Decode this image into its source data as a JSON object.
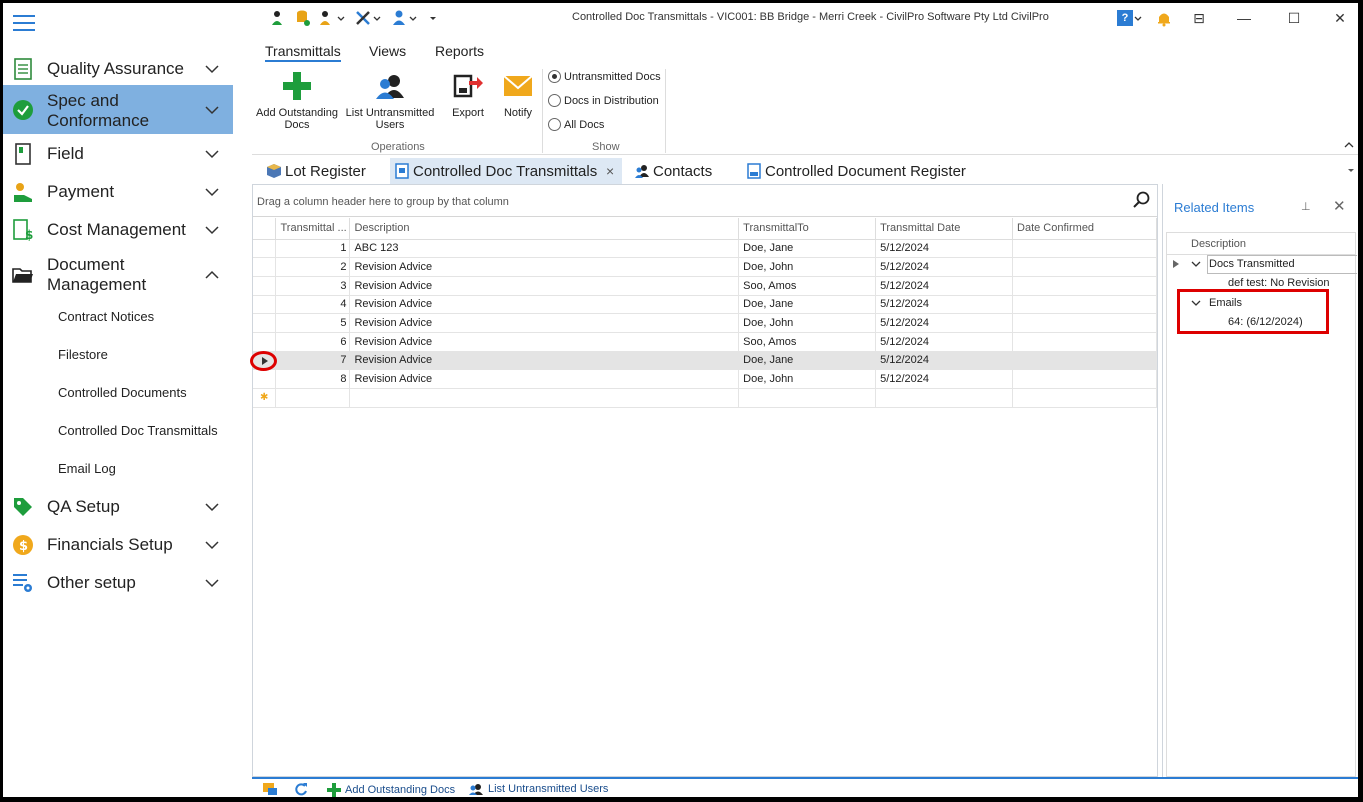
{
  "window": {
    "title": "Controlled Doc Transmittals - VIC001: BB Bridge -  Merri Creek  - CivilPro Software Pty Ltd CivilPro",
    "help_label": "?",
    "restore_label": "⊟",
    "minimize_label": "—",
    "maximize_label": "☐",
    "close_label": "✕"
  },
  "sidebar": {
    "items": [
      {
        "label": "Quality Assurance"
      },
      {
        "label": "Spec and\nConformance"
      },
      {
        "label": "Field"
      },
      {
        "label": "Payment"
      },
      {
        "label": "Cost Management"
      },
      {
        "label": "Document\nManagement"
      },
      {
        "label": "QA Setup"
      },
      {
        "label": "Financials Setup"
      },
      {
        "label": "Other setup"
      }
    ],
    "sub_items": [
      "Contract Notices",
      "Filestore",
      "Controlled Documents",
      "Controlled Doc Transmittals",
      "Email Log"
    ]
  },
  "ribbon": {
    "tabs": [
      "Transmittals",
      "Views",
      "Reports"
    ],
    "buttons": {
      "add_outstanding": "Add Outstanding\nDocs",
      "list_untransmitted": "List Untransmitted\nUsers",
      "export": "Export",
      "notify": "Notify"
    },
    "groups": {
      "operations": "Operations",
      "show": "Show"
    },
    "radios": [
      "Untransmitted Docs",
      "Docs in Distribution",
      "All Docs"
    ],
    "selected_radio": 0
  },
  "doc_tabs": [
    "Lot Register",
    "Controlled Doc Transmittals",
    "Contacts",
    "Controlled Document Register"
  ],
  "doc_tab_close": "×",
  "grid": {
    "group_hint": "Drag a column header here to group by that column",
    "columns": [
      "Transmittal ...",
      "Description",
      "TransmittalTo",
      "Transmittal Date",
      "Date Confirmed"
    ],
    "rows": [
      [
        "1",
        "ABC 123",
        "Doe, Jane",
        "5/12/2024",
        ""
      ],
      [
        "2",
        "Revision Advice",
        "Doe, John",
        "5/12/2024",
        ""
      ],
      [
        "3",
        "Revision Advice",
        "Soo, Amos",
        "5/12/2024",
        ""
      ],
      [
        "4",
        "Revision Advice",
        "Doe, Jane",
        "5/12/2024",
        ""
      ],
      [
        "5",
        "Revision Advice",
        "Doe, John",
        "5/12/2024",
        ""
      ],
      [
        "6",
        "Revision Advice",
        "Soo, Amos",
        "5/12/2024",
        ""
      ],
      [
        "7",
        "Revision Advice",
        "Doe, Jane",
        "5/12/2024",
        ""
      ],
      [
        "8",
        "Revision Advice",
        "Doe, John",
        "5/12/2024",
        ""
      ]
    ],
    "selected_row": 6,
    "new_row_marker": "✱"
  },
  "related": {
    "title": "Related Items",
    "pin": "⊥",
    "close": "✕",
    "column": "Description",
    "docs_group": "Docs Transmitted",
    "docs_item": "def test: No Revision",
    "emails_group": "Emails",
    "emails_item": "64: (6/12/2024)"
  },
  "bottom_bar": {
    "add_outstanding": "Add Outstanding Docs",
    "list_untransmitted": "List Untransmitted Users"
  },
  "colors": {
    "accent": "#2b7cd3",
    "active_nav": "#7fb0e0",
    "highlight": "#dd0000"
  }
}
